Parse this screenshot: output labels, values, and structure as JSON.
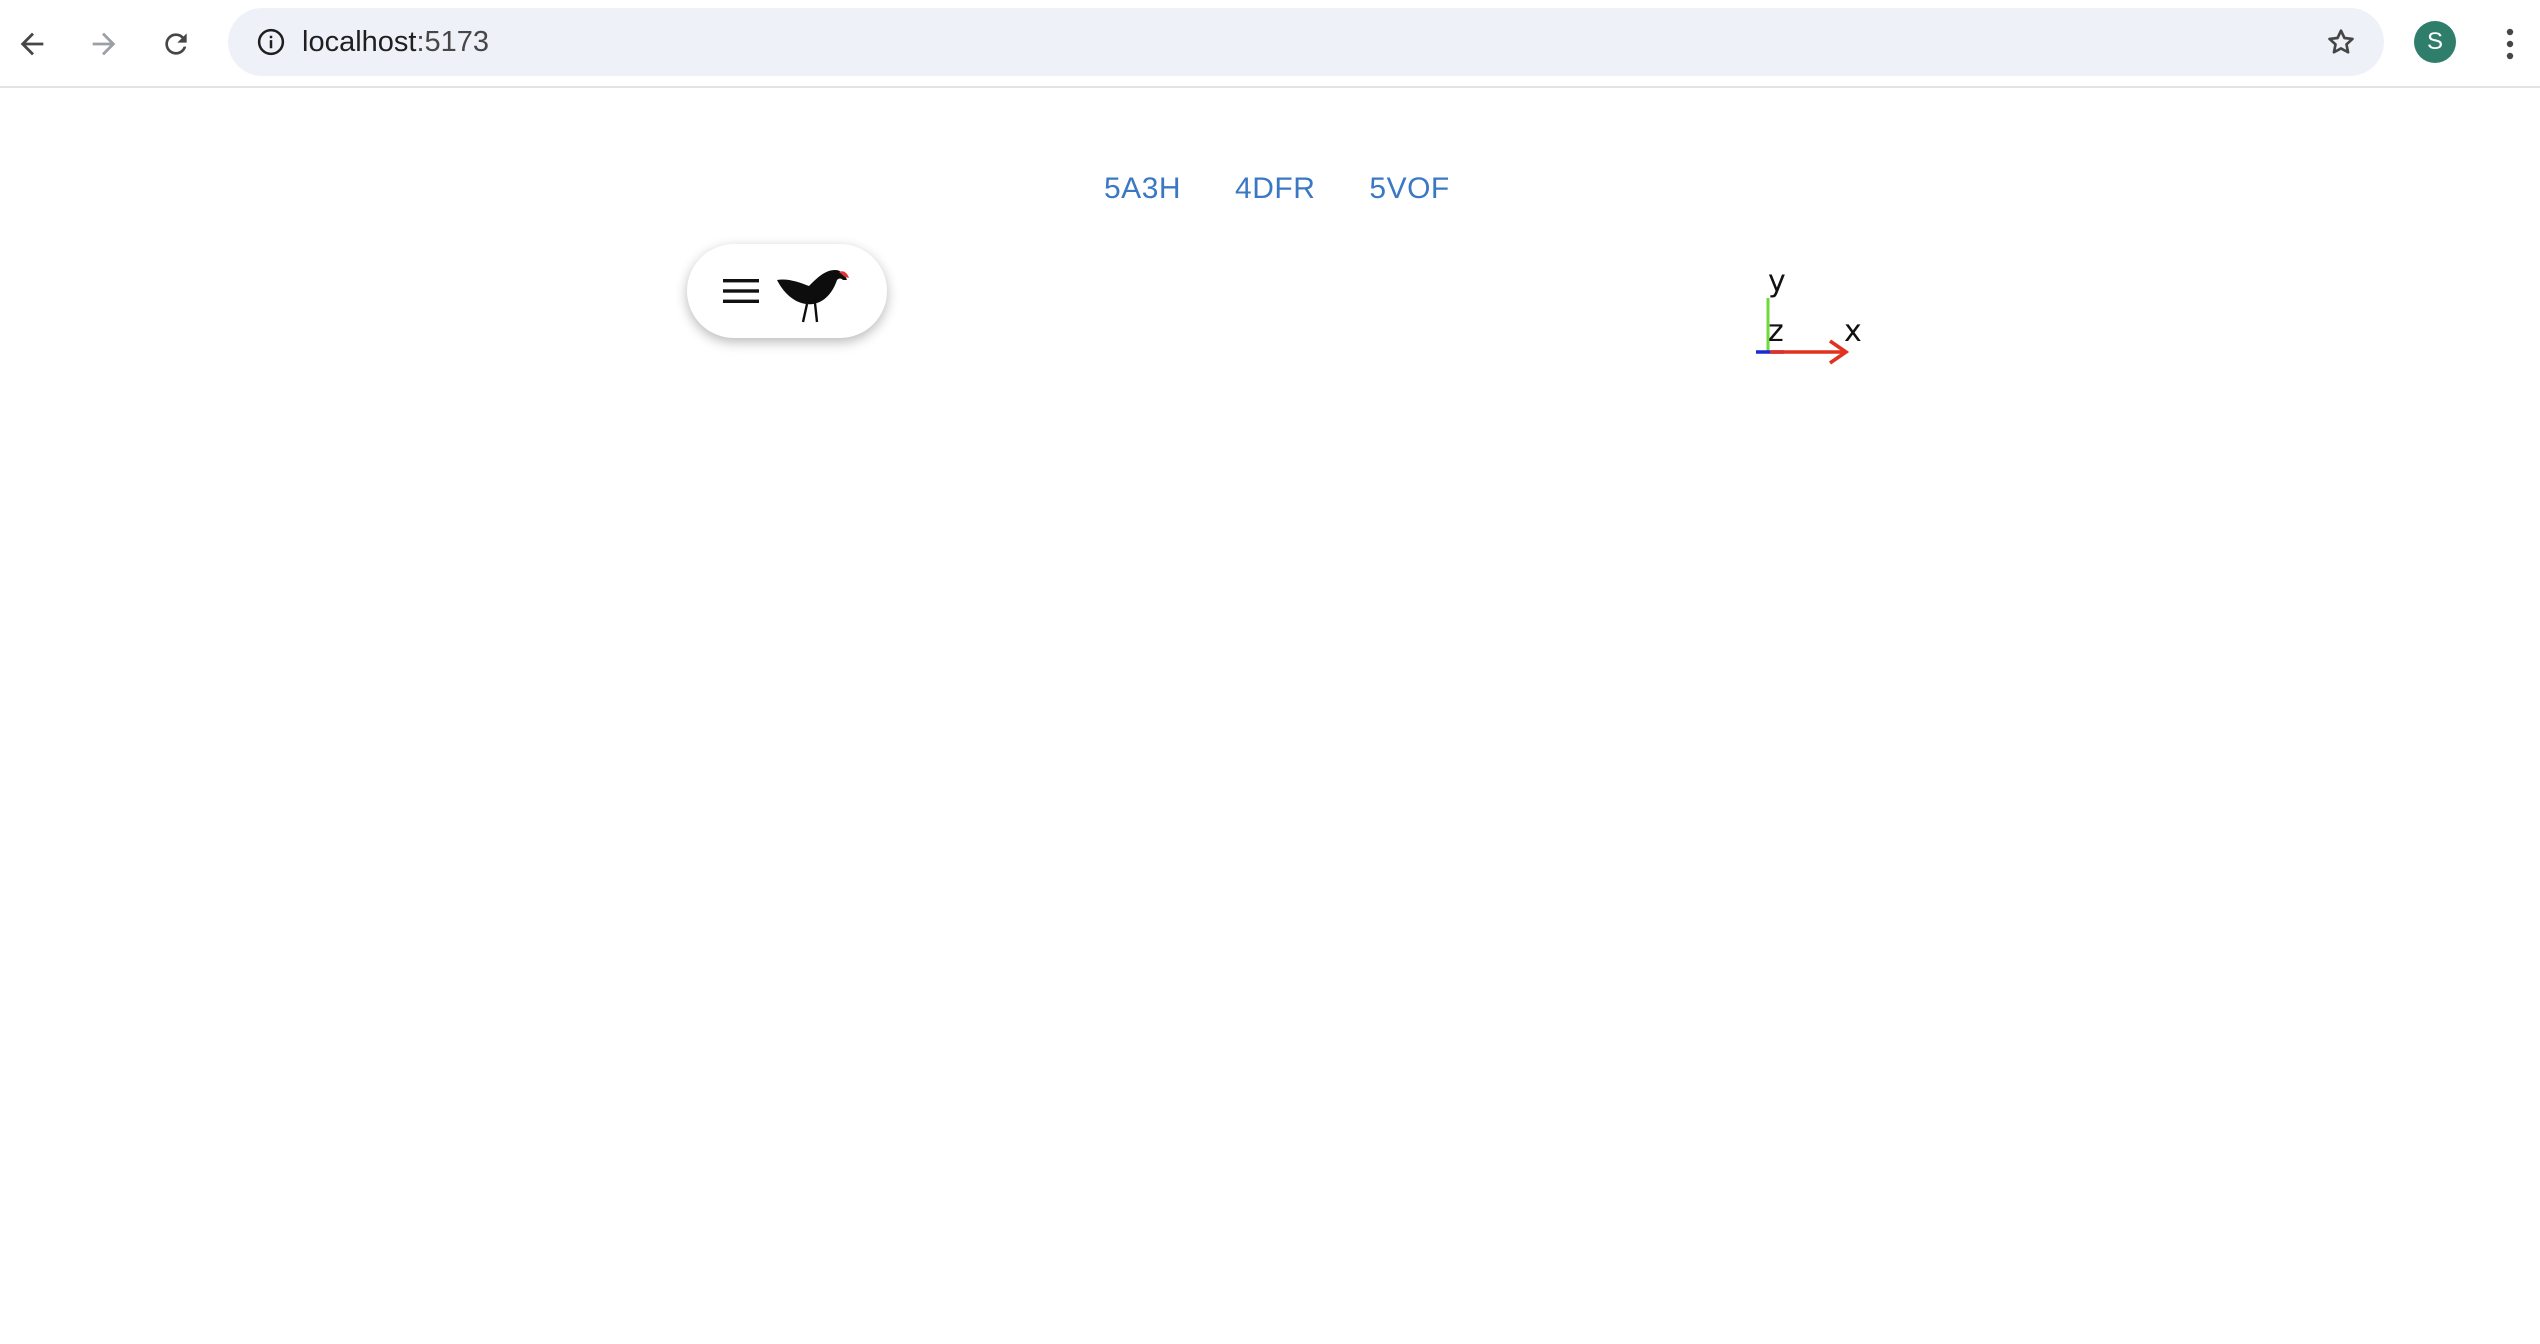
{
  "browser": {
    "url_host": "localhost",
    "url_port": ":5173",
    "profile_initial": "S",
    "icons": {
      "back": "arrow-left-icon",
      "forward": "arrow-right-icon",
      "reload": "reload-icon",
      "info": "info-circle-icon",
      "bookmark": "star-icon",
      "menu": "kebab-menu-icon"
    },
    "colors": {
      "omnibox_bg": "#eef2f8",
      "avatar_bg": "#2f7d6b"
    }
  },
  "page": {
    "entries": [
      {
        "label": "5A3H"
      },
      {
        "label": "4DFR"
      },
      {
        "label": "5VOF"
      }
    ],
    "link_color": "#3a78c4",
    "toolbar_pill": {
      "menu_icon": "hamburger-menu-icon",
      "logo_icon": "bird-logo-icon"
    },
    "axes_gizmo": {
      "x_label": "x",
      "y_label": "y",
      "z_label": "z",
      "x_color": "#e0321e",
      "y_color": "#6fd83a",
      "z_color": "#1a2bd6"
    }
  }
}
